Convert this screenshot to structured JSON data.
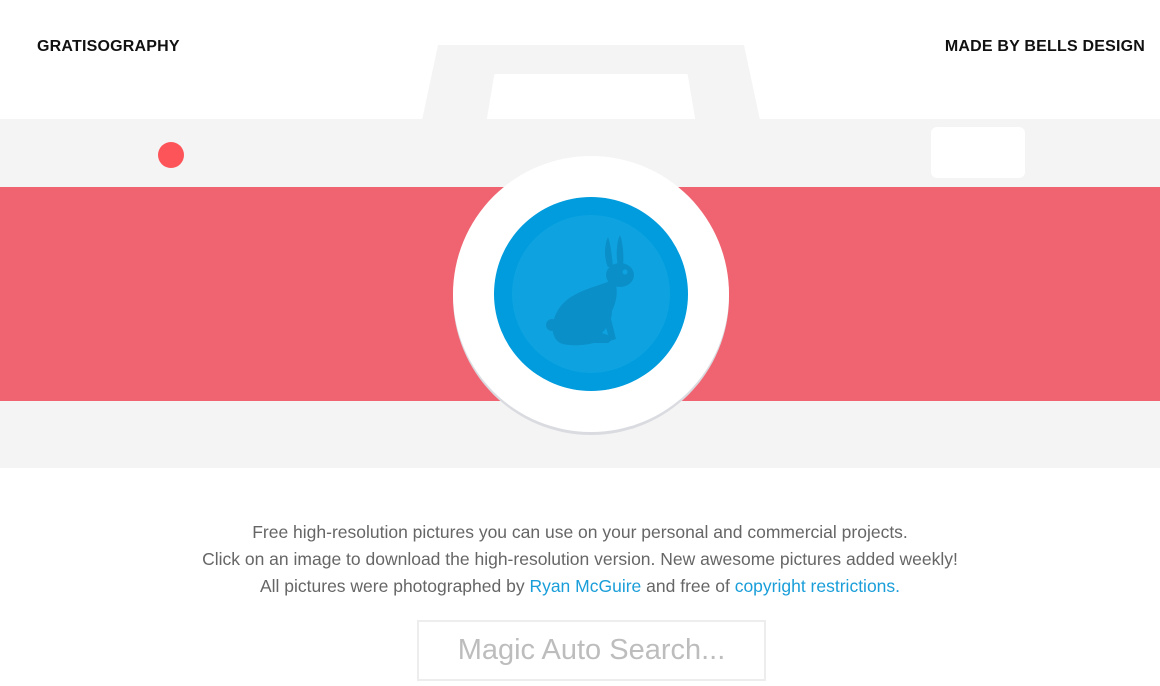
{
  "header": {
    "brand": "GRATISOGRAPHY",
    "credit": "MADE BY BELLS DESIGN"
  },
  "camera": {
    "body_color": "#f5f4f4",
    "band_color": "#f06472",
    "indicator_color": "#fc5458",
    "lens_color": "#009cde",
    "lens_icon": "rabbit-icon"
  },
  "intro": {
    "line1": "Free high-resolution pictures you can use on your personal and commercial projects.",
    "line2": "Click on an image to download the high-resolution version. New awesome pictures added weekly!",
    "line3_prefix": "All pictures were photographed by ",
    "photographer_link": "Ryan McGuire",
    "line3_middle": " and free of ",
    "copyright_link": "copyright restrictions."
  },
  "search": {
    "placeholder": "Magic Auto Search...",
    "value": ""
  }
}
